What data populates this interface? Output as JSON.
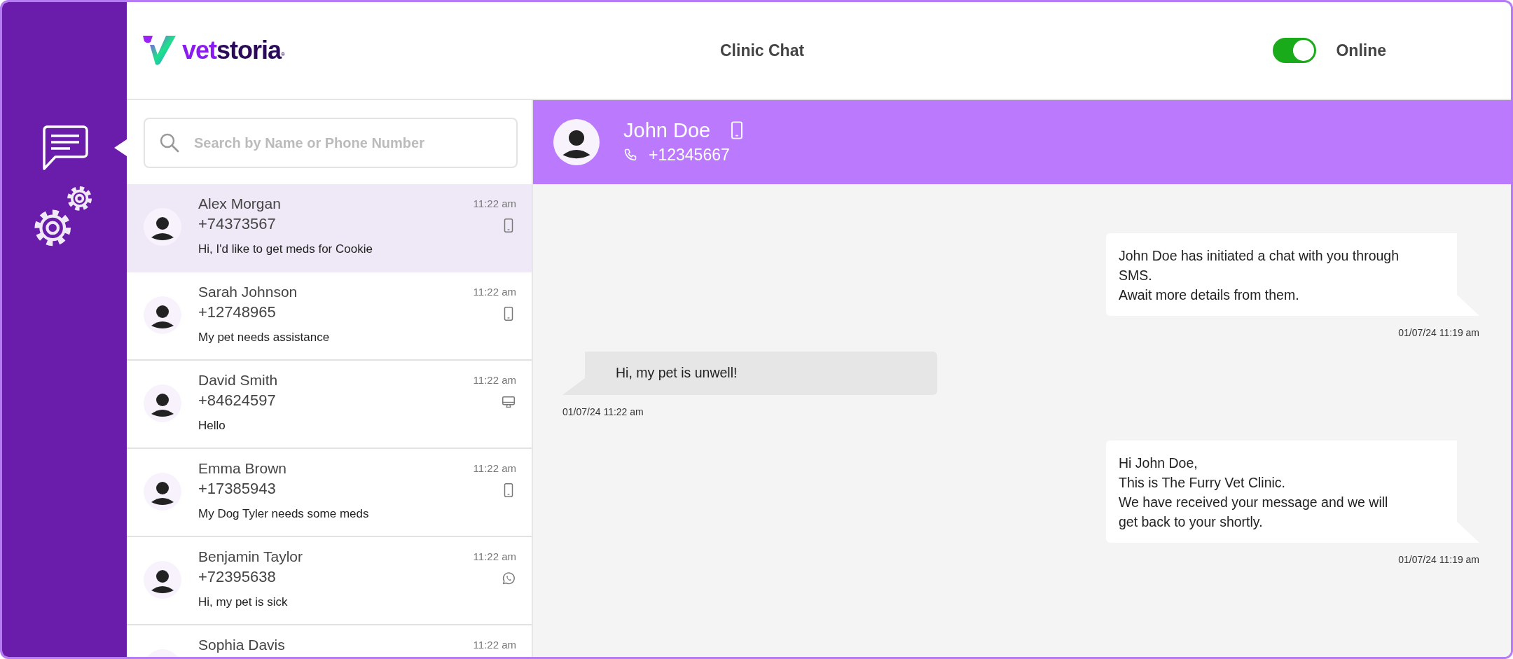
{
  "header": {
    "logo": {
      "accent": "vet",
      "rest": "storia",
      "mark": "®"
    },
    "title": "Clinic Chat",
    "status": {
      "label": "Online",
      "on": true
    }
  },
  "sidebar": {
    "items": [
      {
        "kind": "chat",
        "selected": true
      },
      {
        "kind": "settings",
        "selected": false
      }
    ]
  },
  "search": {
    "placeholder": "Search by Name or Phone Number"
  },
  "contacts": [
    {
      "name": "Alex Morgan",
      "phone": "+74373567",
      "preview": "Hi, I'd like to get meds for Cookie",
      "time": "11:22 am",
      "kind": "mobile",
      "selected": true
    },
    {
      "name": "Sarah Johnson",
      "phone": "+12748965",
      "preview": "My pet needs assistance",
      "time": "11:22 am",
      "kind": "mobile",
      "selected": false
    },
    {
      "name": "David Smith",
      "phone": "+84624597",
      "preview": "Hello",
      "time": "11:22 am",
      "kind": "desktop",
      "selected": false
    },
    {
      "name": "Emma Brown",
      "phone": "+17385943",
      "preview": "My Dog Tyler needs some meds",
      "time": "11:22 am",
      "kind": "mobile",
      "selected": false
    },
    {
      "name": "Benjamin Taylor",
      "phone": "+72395638",
      "preview": "Hi, my pet is sick",
      "time": "11:22 am",
      "kind": "whatsapp",
      "selected": false
    },
    {
      "name": "Sophia Davis",
      "time": "11:22 am",
      "selected": false
    }
  ],
  "conversation": {
    "name": "John Doe",
    "kind": "mobile",
    "phone": "+12345667"
  },
  "messages": [
    {
      "kind": "outgoing",
      "text": "John Doe has initiated a chat with you through\nSMS.\nAwait more details from them.",
      "time": "01/07/24 11:19 am"
    },
    {
      "kind": "incoming",
      "text": "Hi, my pet is unwell!",
      "time": "01/07/24 11:22 am"
    },
    {
      "kind": "outgoing",
      "text": "Hi John Doe,\nThis is The Furry Vet Clinic.\nWe have received your message and we will\nget back to your shortly.",
      "time": "01/07/24 11:19 am"
    }
  ]
}
